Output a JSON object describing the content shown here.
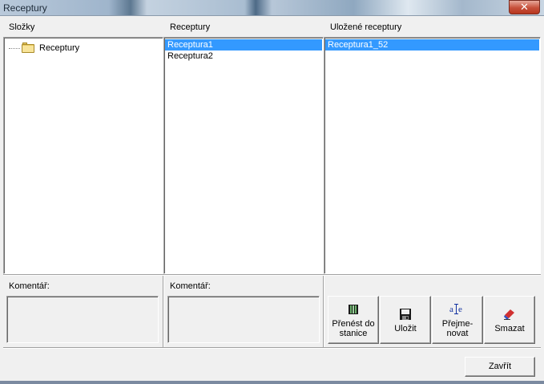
{
  "window": {
    "title": "Receptury",
    "close_glyph": "✕"
  },
  "headers": {
    "folders": "Složky",
    "recipes": "Receptury",
    "saved": "Uložené receptury"
  },
  "folders": {
    "root_label": "Receptury"
  },
  "recipes": {
    "items": [
      "Receptura1",
      "Receptura2"
    ],
    "selected_index": 0
  },
  "saved": {
    "items": [
      "Receptura1_52"
    ],
    "selected_index": 0
  },
  "comments": {
    "label_1": "Komentář:",
    "label_2": "Komentář:",
    "value_1": "",
    "value_2": ""
  },
  "actions": {
    "transfer_line1": "Přenést do",
    "transfer_line2": "stanice",
    "save": "Uložit",
    "rename_line1": "Přejme-",
    "rename_line2": "novat",
    "delete": "Smazat"
  },
  "footer": {
    "close_label": "Zavřít"
  },
  "colors": {
    "selection": "#3399ff",
    "background": "#f0f0f0"
  }
}
